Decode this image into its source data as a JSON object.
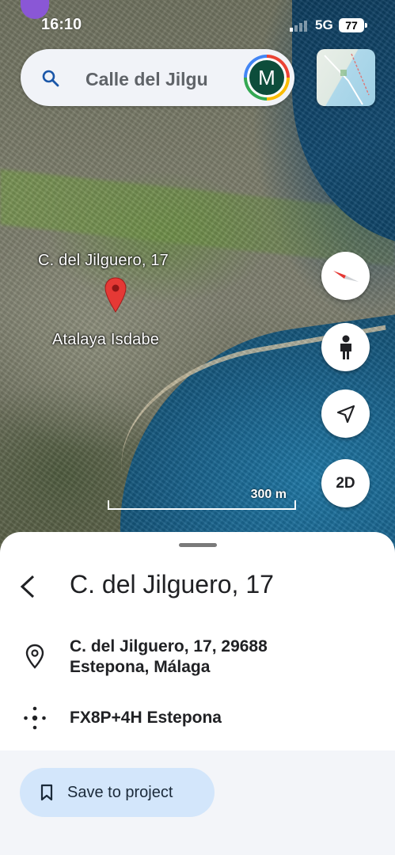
{
  "status_bar": {
    "time": "16:10",
    "network": "5G",
    "battery": "77"
  },
  "search": {
    "value": "Calle del Jilgu",
    "avatar_letter": "M"
  },
  "map": {
    "labels": {
      "place": "C. del Jilguero, 17",
      "area": "Atalaya Isdabe"
    },
    "scale": "300 m",
    "view_toggle": "2D"
  },
  "sheet": {
    "title": "C. del Jilguero, 17",
    "address_line1": "C. del Jilguero, 17, 29688",
    "address_line2": "Estepona, Málaga",
    "plus_code": "FX8P+4H Estepona",
    "save_button": "Save to project"
  },
  "colors": {
    "pin": "#e53935",
    "save_button_bg": "#d3e6fb",
    "avatar_bg": "#0d4d3b"
  },
  "icons": [
    "search-icon",
    "compass-icon",
    "street-view-icon",
    "my-location-icon",
    "back-arrow-icon",
    "location-pin-icon",
    "plus-code-icon",
    "bookmark-icon",
    "map-pin"
  ]
}
